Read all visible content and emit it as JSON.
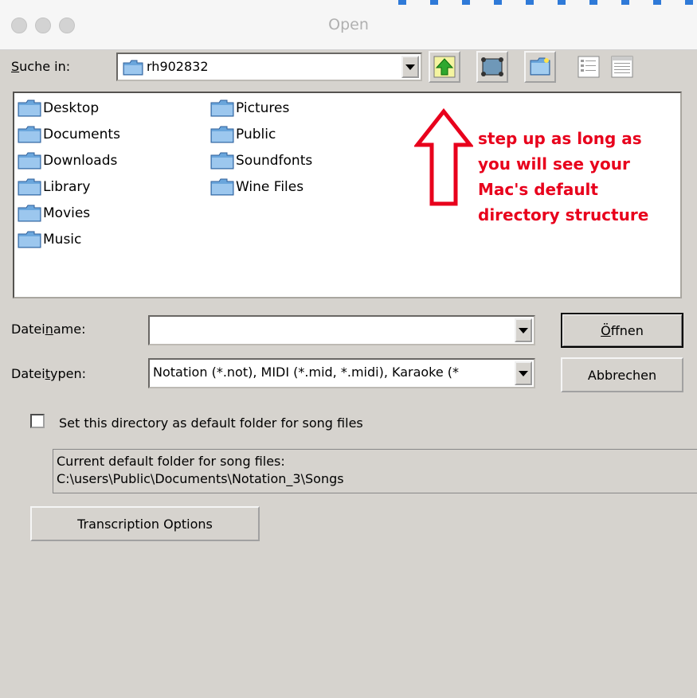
{
  "window": {
    "title": "Open"
  },
  "look_in": {
    "label_pre": "S",
    "label_post": "uche in:",
    "value": "rh902832"
  },
  "toolbar": {
    "up_icon": "up-arrow-icon",
    "desktop_icon": "desktop-icon",
    "new_folder_icon": "new-folder-icon",
    "list_view_icon": "list-view-icon",
    "details_view_icon": "details-view-icon"
  },
  "files": [
    {
      "name": "Desktop"
    },
    {
      "name": "Documents"
    },
    {
      "name": "Downloads"
    },
    {
      "name": "Library"
    },
    {
      "name": "Movies"
    },
    {
      "name": "Music"
    },
    {
      "name": "Pictures"
    },
    {
      "name": "Public"
    },
    {
      "name": "Soundfonts"
    },
    {
      "name": "Wine Files"
    }
  ],
  "annotation": {
    "lines": [
      "step up as long as",
      "you will see your",
      "Mac's default",
      "directory structure"
    ],
    "color": "#e8001c"
  },
  "filename": {
    "label_pre": "Datei",
    "label_u": "n",
    "label_post": "ame:",
    "value": ""
  },
  "filetype": {
    "label_pre": "Datei",
    "label_u": "t",
    "label_post": "ypen:",
    "value": "Notation (*.not), MIDI (*.mid, *.midi), Karaoke (*"
  },
  "buttons": {
    "open_u": "Ö",
    "open_rest": "ffnen",
    "cancel": "Abbrechen",
    "transcription": "Transcription Options"
  },
  "default_folder": {
    "checkbox_label": "Set this directory as default folder for song files",
    "checked": false,
    "info_line1": "Current default folder for song files:",
    "info_line2": "C:\\users\\Public\\Documents\\Notation_3\\Songs"
  }
}
